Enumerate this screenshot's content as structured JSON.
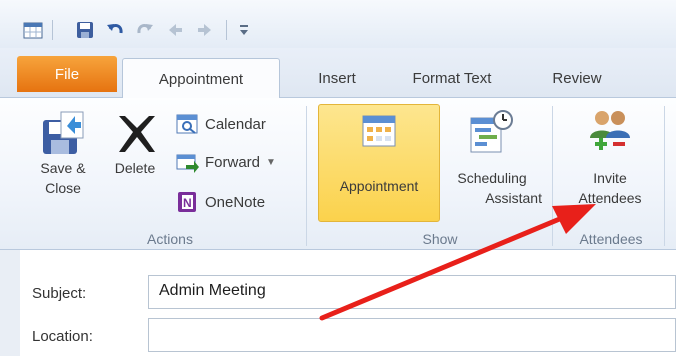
{
  "tabs": {
    "file": "File",
    "appointment": "Appointment",
    "insert": "Insert",
    "format_text": "Format Text",
    "review": "Review"
  },
  "ribbon": {
    "actions": {
      "label": "Actions",
      "save_close_line1": "Save &",
      "save_close_line2": "Close",
      "delete": "Delete",
      "calendar": "Calendar",
      "forward": "Forward",
      "onenote": "OneNote"
    },
    "show": {
      "label": "Show",
      "appointment": "Appointment",
      "scheduling_line1": "Scheduling",
      "scheduling_line2": "Assistant"
    },
    "attendees": {
      "label": "Attendees",
      "invite_line1": "Invite",
      "invite_line2": "Attendees"
    }
  },
  "form": {
    "subject_label": "Subject:",
    "subject_value": "Admin Meeting",
    "location_label": "Location:",
    "location_value": ""
  },
  "colors": {
    "file_tab": "#e67310",
    "highlight": "#fbd24c",
    "arrow": "#e8201a"
  }
}
